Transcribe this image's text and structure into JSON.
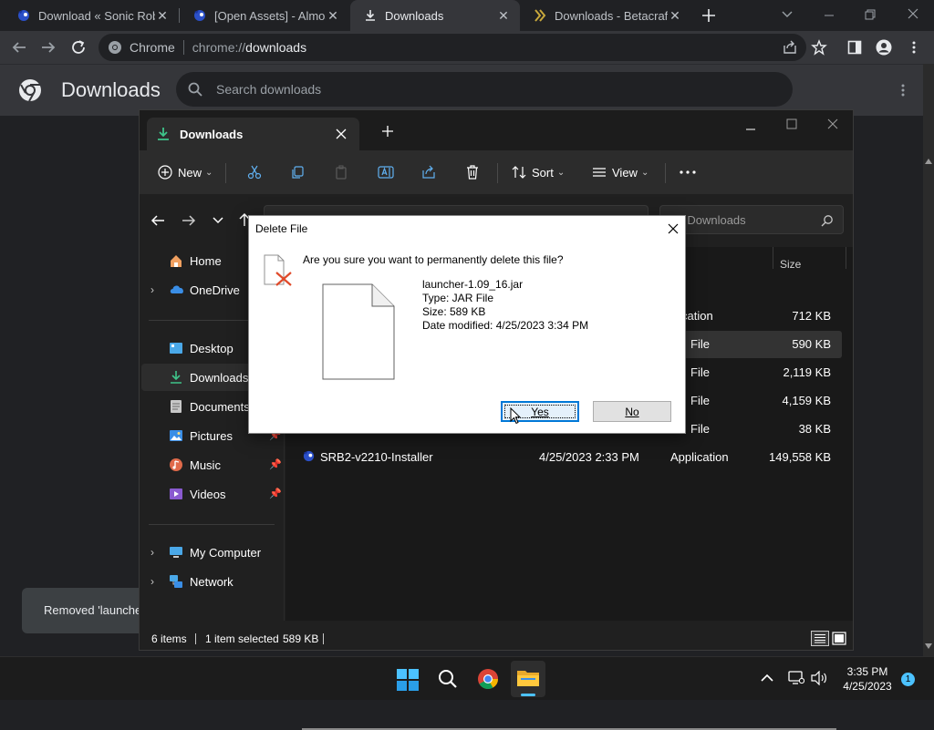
{
  "browser": {
    "tabs": [
      {
        "title": "Download « Sonic Rob",
        "icon": "sonic-icon"
      },
      {
        "title": "[Open Assets] - Almost",
        "icon": "sonic-icon"
      },
      {
        "title": "Downloads",
        "icon": "download-icon",
        "active": true
      },
      {
        "title": "Downloads - Betacraft",
        "icon": "betacraft-icon"
      }
    ],
    "site_label": "Chrome",
    "url_scheme": "chrome://",
    "url_path": "downloads"
  },
  "downloads_page": {
    "title": "Downloads",
    "search_placeholder": "Search downloads",
    "toast": "Removed 'launcher"
  },
  "explorer": {
    "tab_title": "Downloads",
    "ribbon": {
      "new": "New",
      "sort": "Sort",
      "view": "View"
    },
    "search_placeholder": "ch Downloads",
    "nav": [
      {
        "label": "Home",
        "icon": "home-icon"
      },
      {
        "label": "OneDrive",
        "icon": "cloud-icon"
      },
      {
        "label": "Desktop",
        "icon": "desktop-icon"
      },
      {
        "label": "Downloads",
        "icon": "download-icon"
      },
      {
        "label": "Documents",
        "icon": "documents-icon"
      },
      {
        "label": "Pictures",
        "icon": "pictures-icon"
      },
      {
        "label": "Music",
        "icon": "music-icon"
      },
      {
        "label": "Videos",
        "icon": "videos-icon"
      },
      {
        "label": "My Computer",
        "icon": "computer-icon"
      },
      {
        "label": "Network",
        "icon": "network-icon"
      }
    ],
    "columns": {
      "type": "e",
      "size": "Size"
    },
    "rows": [
      {
        "name": "",
        "date": "",
        "type": "plication",
        "size": "712 KB"
      },
      {
        "name": "",
        "date": "",
        "type": "File",
        "size": "590 KB"
      },
      {
        "name": "",
        "date": "",
        "type": "File",
        "size": "2,119 KB"
      },
      {
        "name": "",
        "date": "",
        "type": "File",
        "size": "4,159 KB"
      },
      {
        "name": "",
        "date": "",
        "type": "File",
        "size": "38 KB"
      },
      {
        "name": "SRB2-v2210-Installer",
        "date": "4/25/2023 2:33 PM",
        "type": "Application",
        "size": "149,558 KB"
      }
    ],
    "status": {
      "items": "6 items",
      "selected": "1 item selected",
      "size": "589 KB"
    }
  },
  "dialog": {
    "title": "Delete File",
    "question": "Are you sure you want to permanently delete this file?",
    "file_name": "launcher-1.09_16.jar",
    "file_type": "Type: JAR File",
    "file_size": "Size: 589 KB",
    "date_modified": "Date modified: 4/25/2023 3:34 PM",
    "yes_label": "Yes",
    "no_label": "No"
  },
  "taskbar": {
    "time": "3:35 PM",
    "date": "4/25/2023",
    "notification_count": "1"
  },
  "colors": {
    "accent": "#0078d7",
    "chrome_dark": "#202124",
    "explorer_bg": "#202020"
  }
}
